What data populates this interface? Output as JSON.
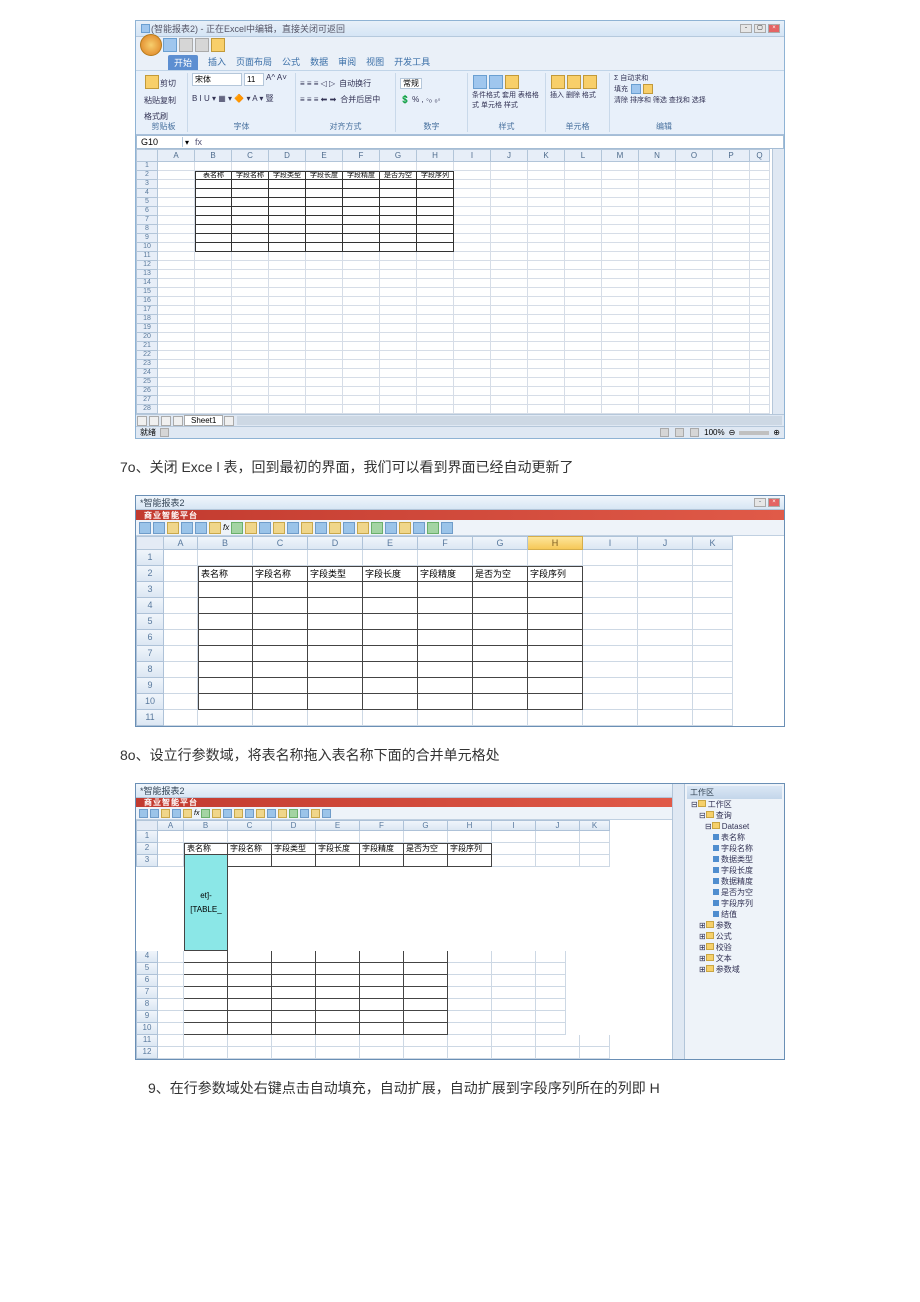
{
  "text": {
    "step7": "7o、关闭 Exce l 表，回到最初的界面，我们可以看到界面已经自动更新了",
    "step8": "8o、设立行参数域，将表名称拖入表名称下面的合并单元格处",
    "step9": "9、在行参数域处右键点击自动填充，自动扩展，自动扩展到字段序列所在的列即 H"
  },
  "excel": {
    "title": "(智能报表2) - 正在Excel中编辑，直接关闭可返回",
    "tabs": [
      "开始",
      "插入",
      "页面布局",
      "公式",
      "数据",
      "审阅",
      "视图",
      "开发工具"
    ],
    "groups": {
      "clipboard": "剪贴板",
      "font": "字体",
      "align": "对齐方式",
      "number": "数字",
      "styles": "样式",
      "cells": "单元格",
      "editing": "编辑"
    },
    "clipboard": {
      "paste": "粘贴",
      "cut": "剪切",
      "copy": "复制",
      "painter": "格式刷"
    },
    "font": {
      "name": "宋体",
      "size": "11"
    },
    "number_fmt": "常规",
    "align": {
      "wrap": "自动换行",
      "merge": "合并后居中"
    },
    "styles": {
      "cond": "条件格式",
      "table": "套用\n表格格式",
      "cell": "单元格\n样式"
    },
    "cells": {
      "insert": "插入",
      "delete": "删除",
      "format": "格式"
    },
    "editing": {
      "sum": "Σ 自动求和",
      "fill": "填充",
      "clear": "清除",
      "sort": "排序和\n筛选",
      "find": "查找和\n选择"
    },
    "cellref": "G10",
    "cols": [
      "A",
      "B",
      "C",
      "D",
      "E",
      "F",
      "G",
      "H",
      "I",
      "J",
      "K",
      "L",
      "M",
      "N",
      "O",
      "P",
      "Q"
    ],
    "headers": [
      "表名称",
      "字段名称",
      "字段类型",
      "字段长度",
      "字段精度",
      "是否为空",
      "字段序列"
    ],
    "sheet": "Sheet1",
    "status": "就绪",
    "zoom": "100%"
  },
  "rep2": {
    "title": "*智能报表2",
    "banner": "商业智能平台",
    "cols": [
      "A",
      "B",
      "C",
      "D",
      "E",
      "F",
      "G",
      "H",
      "I",
      "J",
      "K"
    ],
    "headers": [
      "表名称",
      "字段名称",
      "字段类型",
      "字段长度",
      "字段精度",
      "是否为空",
      "字段序列"
    ]
  },
  "rep3": {
    "title": "*智能报表2",
    "cols": [
      "A",
      "B",
      "C",
      "D",
      "E",
      "F",
      "G",
      "H",
      "I",
      "J",
      "K"
    ],
    "headers": [
      "表名称",
      "字段名称",
      "字段类型",
      "字段长度",
      "字段精度",
      "是否为空",
      "字段序列"
    ],
    "merged_cell": "et]-[TABLE_",
    "tree": {
      "root": "工作区",
      "query": "查询",
      "dataset": "Dataset",
      "fields": [
        "表名称",
        "字段名称",
        "数据类型",
        "字段长度",
        "数据精度",
        "是否为空",
        "字段序列",
        "结值"
      ],
      "params": "参数",
      "formula": "公式",
      "check": "校验",
      "text": "文本",
      "paramdom": "参数域"
    }
  }
}
